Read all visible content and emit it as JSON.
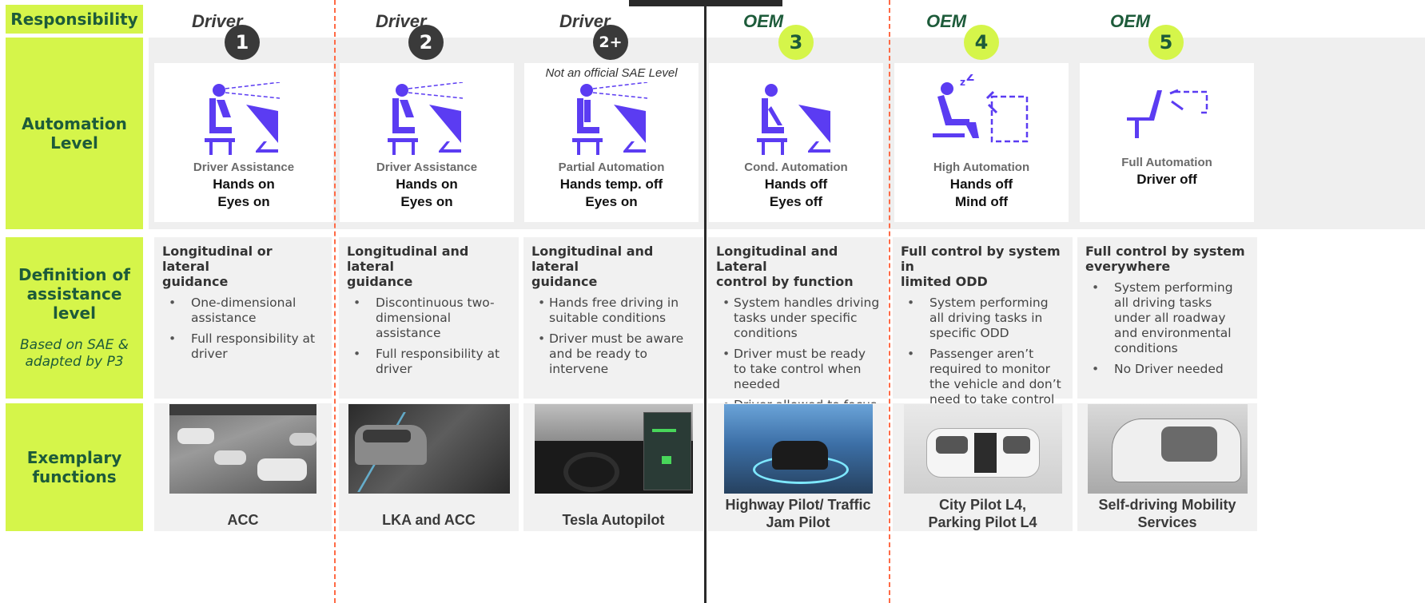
{
  "row_labels": {
    "responsibility": "Responsibility",
    "automation_level": [
      "Automation",
      "Level"
    ],
    "definition": [
      "Definition of",
      "assistance level"
    ],
    "definition_note": [
      "Based on SAE &",
      "adapted by P3"
    ],
    "exemplary": [
      "Exemplary",
      "functions"
    ]
  },
  "levels": [
    {
      "responsibility": "Driver",
      "badge": "1",
      "badge_style": "driver",
      "note": "",
      "category": "Driver Assistance",
      "state_line1": "Hands on",
      "state_line2": "Eyes on",
      "icon": "driver-eyes-on-icon",
      "def_title": [
        "Longitudinal or lateral",
        "guidance"
      ],
      "bullets": [
        "One-dimensional assistance",
        "Full responsibility at driver"
      ],
      "example": [
        "ACC"
      ],
      "photo": "highway-traffic-photo"
    },
    {
      "responsibility": "Driver",
      "badge": "2",
      "badge_style": "driver",
      "note": "",
      "category": "Driver Assistance",
      "state_line1": "Hands on",
      "state_line2": "Eyes on",
      "icon": "driver-eyes-on-icon",
      "def_title": [
        "Longitudinal and lateral",
        "guidance"
      ],
      "bullets": [
        "Discontinuous two-dimensional assistance",
        "Full responsibility at driver"
      ],
      "example": [
        "LKA and ACC"
      ],
      "photo": "suv-lane-keeping-photo"
    },
    {
      "responsibility": "Driver",
      "badge": "2+",
      "badge_style": "driver",
      "note": "Not an official SAE Level",
      "category": "Partial Automation",
      "state_line1": "Hands temp. off",
      "state_line2": "Eyes on",
      "icon": "driver-hands-off-icon",
      "def_title": [
        "Longitudinal and lateral",
        "guidance"
      ],
      "bullets": [
        "Hands free driving in suitable conditions",
        "Driver must be aware and be ready to intervene"
      ],
      "example": [
        "Tesla Autopilot"
      ],
      "photo": "tesla-cockpit-photo"
    },
    {
      "responsibility": "OEM",
      "badge": "3",
      "badge_style": "oem",
      "note": "",
      "category": "Cond. Automation",
      "state_line1": "Hands off",
      "state_line2": "Eyes off",
      "icon": "driver-eyes-off-icon",
      "def_title": [
        "Longitudinal and Lateral",
        "control by function"
      ],
      "bullets": [
        "System handles driving tasks under specific conditions",
        "Driver must be ready to take control when needed",
        "Driver allowed to focus on side activities"
      ],
      "example": [
        "Highway Pilot/ Traffic",
        "Jam Pilot"
      ],
      "photo": "sedan-highway-pilot-photo"
    },
    {
      "responsibility": "OEM",
      "badge": "4",
      "badge_style": "oem",
      "note": "",
      "category": "High Automation",
      "state_line1": "Hands off",
      "state_line2": "Mind off",
      "icon": "driver-sleeping-icon",
      "def_title": [
        "Full control by system in",
        "limited ODD"
      ],
      "bullets": [
        "System performing all driving tasks in specific ODD",
        "Passenger aren’t required to monitor the vehicle and don’t need to take control"
      ],
      "example": [
        "City Pilot L4,",
        "Parking Pilot L4"
      ],
      "photo": "robotaxi-van-photo"
    },
    {
      "responsibility": "OEM",
      "badge": "5",
      "badge_style": "oem",
      "note": "",
      "category": "Full Automation",
      "state_line1": "Driver off",
      "state_line2": "",
      "icon": "empty-seat-icon",
      "def_title": [
        "Full control by system",
        "everywhere"
      ],
      "bullets": [
        "System performing all driving tasks under all roadway and environmental conditions",
        "No Driver needed"
      ],
      "example": [
        "Self-driving Mobility",
        "Services"
      ],
      "photo": "autonomous-pod-photo"
    }
  ],
  "colors": {
    "accent_green": "#d5f54a",
    "label_green": "#1d5b3a",
    "icon_purple": "#5b3cf2",
    "divider_orange": "#ff6a45",
    "badge_dark": "#3a3a3a"
  }
}
